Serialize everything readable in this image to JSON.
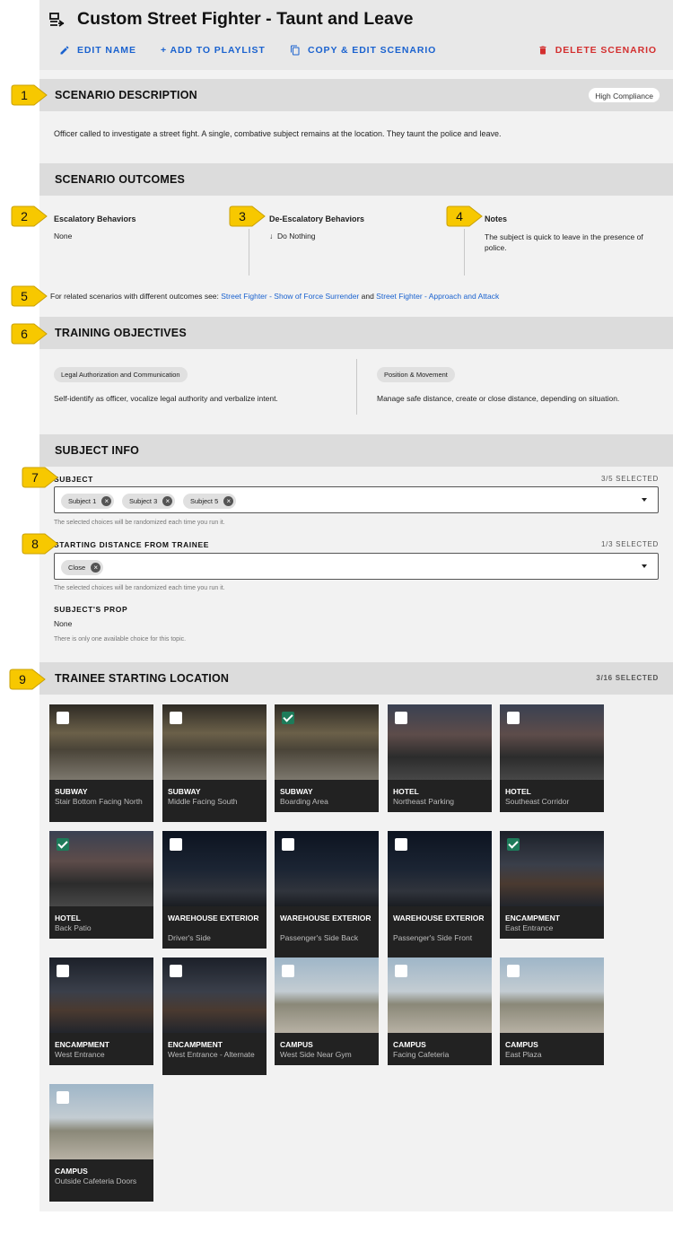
{
  "header": {
    "title": "Custom Street Fighter - Taunt and Leave",
    "actions": {
      "edit_name": "EDIT NAME",
      "add_playlist": "+ ADD TO PLAYLIST",
      "copy_edit": "COPY & EDIT SCENARIO",
      "delete": "DELETE SCENARIO"
    }
  },
  "colors": {
    "accent": "#1a62cf",
    "danger": "#d32f2f",
    "badge": "#f7c800",
    "checked": "#1e7b5a"
  },
  "description": {
    "heading": "SCENARIO DESCRIPTION",
    "compliance": "High Compliance",
    "text": "Officer called to investigate a street fight. A single, combative subject remains at the location. They taunt the police and leave."
  },
  "outcomes": {
    "heading": "SCENARIO OUTCOMES",
    "escalatory_title": "Escalatory Behaviors",
    "escalatory_value": "None",
    "deesc_title": "De-Escalatory Behaviors",
    "deesc_value": "Do Nothing",
    "notes_title": "Notes",
    "notes_value": "The subject is quick to leave in the presence of police.",
    "related_prefix": "For related scenarios with different outcomes see: ",
    "related_link1": "Street Fighter - Show of Force Surrender",
    "related_and": " and ",
    "related_link2": "Street Fighter - Approach and Attack"
  },
  "objectives": {
    "heading": "TRAINING OBJECTIVES",
    "items": [
      {
        "tag": "Legal Authorization and Communication",
        "text": "Self-identify as officer, vocalize legal authority and verbalize intent."
      },
      {
        "tag": "Position & Movement",
        "text": "Manage safe distance, create or close distance, depending on situation."
      }
    ]
  },
  "subject_info": {
    "heading": "SUBJECT INFO",
    "subject_label": "SUBJECT",
    "subject_count": "3/5 SELECTED",
    "subject_tags": [
      "Subject 1",
      "Subject 3",
      "Subject 5"
    ],
    "hint": "The selected choices will be randomized each time you run it.",
    "distance_label": "STARTING DISTANCE FROM TRAINEE",
    "distance_count": "1/3 SELECTED",
    "distance_tags": [
      "Close"
    ],
    "prop_label": "SUBJECT'S PROP",
    "prop_value": "None",
    "prop_hint": "There is only one available choice for this topic."
  },
  "locations": {
    "heading": "TRAINEE STARTING LOCATION",
    "count": "3/16 SELECTED",
    "cards": [
      {
        "t": "SUBWAY",
        "s": "Stair Bottom Facing North",
        "checked": false
      },
      {
        "t": "SUBWAY",
        "s": "Middle Facing South",
        "checked": false
      },
      {
        "t": "SUBWAY",
        "s": "Boarding Area",
        "checked": true
      },
      {
        "t": "HOTEL",
        "s": "Northeast Parking",
        "checked": false
      },
      {
        "t": "HOTEL",
        "s": "Southeast Corridor",
        "checked": false
      },
      {
        "t": "HOTEL",
        "s": "Back Patio",
        "checked": true
      },
      {
        "t": "WAREHOUSE EXTERIOR",
        "s": "Driver's Side",
        "checked": false
      },
      {
        "t": "WAREHOUSE EXTERIOR",
        "s": "Passenger's Side Back",
        "checked": false
      },
      {
        "t": "WAREHOUSE EXTERIOR",
        "s": "Passenger's Side Front",
        "checked": false
      },
      {
        "t": "ENCAMPMENT",
        "s": "East Entrance",
        "checked": true
      },
      {
        "t": "ENCAMPMENT",
        "s": "West Entrance",
        "checked": false
      },
      {
        "t": "ENCAMPMENT",
        "s": "West Entrance - Alternate",
        "checked": false
      },
      {
        "t": "CAMPUS",
        "s": "West Side Near Gym",
        "checked": false
      },
      {
        "t": "CAMPUS",
        "s": "Facing Cafeteria",
        "checked": false
      },
      {
        "t": "CAMPUS",
        "s": "East Plaza",
        "checked": false
      },
      {
        "t": "CAMPUS",
        "s": "Outside Cafeteria Doors",
        "checked": false
      }
    ]
  },
  "badges": [
    "1",
    "2",
    "3",
    "4",
    "5",
    "6",
    "7",
    "8",
    "9"
  ]
}
